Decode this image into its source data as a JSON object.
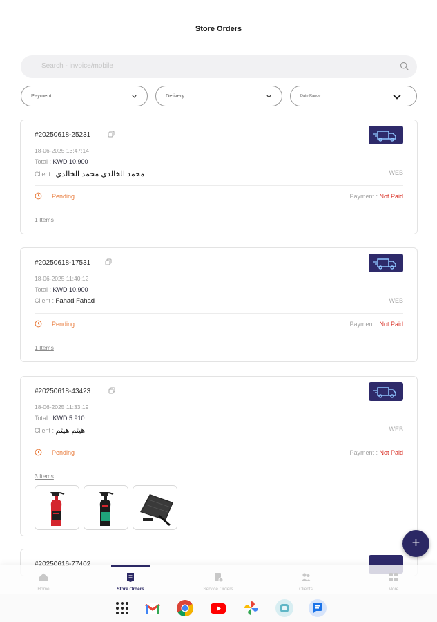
{
  "header": {
    "title": "Store Orders"
  },
  "search": {
    "placeholder": "Search - invoice/mobile",
    "icon": "search-icon"
  },
  "filters": [
    {
      "label": "Payment"
    },
    {
      "label": "Delivery"
    },
    {
      "label": "Date Range"
    }
  ],
  "orders": [
    {
      "id": "#20250618-25231",
      "timestamp": "18-06-2025 13:47:14",
      "total_label": "Total : ",
      "total_value": "KWD 10.900",
      "client_label": "Client : ",
      "client_name": "محمد الخالدي محمد الخالدي",
      "channel": "WEB",
      "status": "Pending",
      "payment_label": "Payment : ",
      "payment_value": "Not Paid",
      "items": "1 Items"
    },
    {
      "id": "#20250618-17531",
      "timestamp": "18-06-2025 11:40:12",
      "total_label": "Total : ",
      "total_value": "KWD 10.900",
      "client_label": "Client : ",
      "client_name": "Fahad Fahad",
      "channel": "WEB",
      "status": "Pending",
      "payment_label": "Payment : ",
      "payment_value": "Not Paid",
      "items": "1 Items"
    },
    {
      "id": "#20250618-43423",
      "timestamp": "18-06-2025 11:33:19",
      "total_label": "Total : ",
      "total_value": "KWD 5.910",
      "client_label": "Client : ",
      "client_name": "هيثم هيثم",
      "channel": "WEB",
      "status": "Pending",
      "payment_label": "Payment : ",
      "payment_value": "Not Paid",
      "items": "3 Items"
    }
  ],
  "next_order_partial": {
    "id": "#20250616-77402"
  },
  "nav": [
    {
      "label": "Home",
      "icon": "home-icon"
    },
    {
      "label": "Store Orders",
      "icon": "store-orders-icon",
      "active": true
    },
    {
      "label": "Service Orders",
      "icon": "service-orders-icon"
    },
    {
      "label": "Clients",
      "icon": "clients-icon"
    },
    {
      "label": "More",
      "icon": "grid-icon"
    }
  ],
  "fab": {
    "label": "+"
  },
  "dock_apps": [
    "app-drawer-icon",
    "gmail-icon",
    "chrome-icon",
    "youtube-icon",
    "photos-icon",
    "app-icon",
    "messages-icon"
  ],
  "colors": {
    "primary": "#2b2864",
    "pending": "#e87a3a",
    "not_paid": "#d93025"
  }
}
